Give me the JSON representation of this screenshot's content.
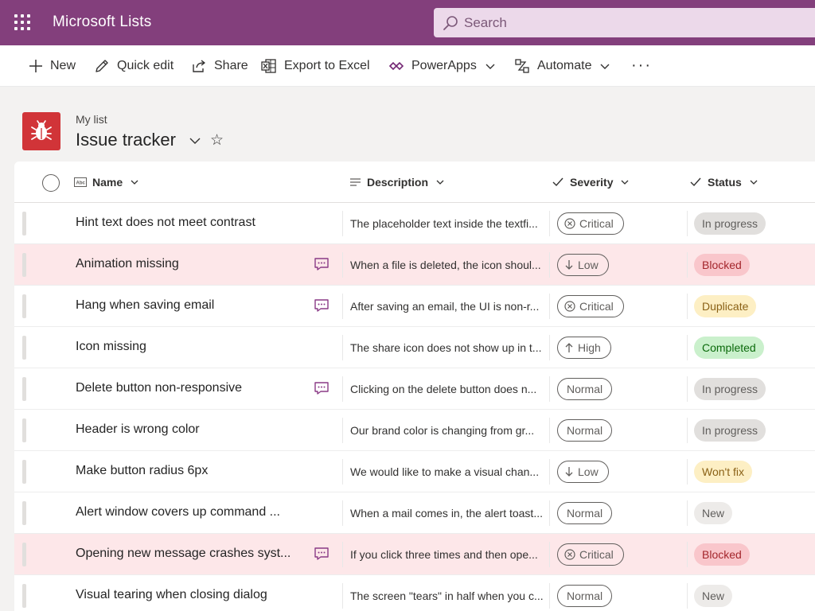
{
  "app": {
    "title": "Microsoft Lists",
    "search_placeholder": "Search"
  },
  "commands": {
    "new": "New",
    "quick_edit": "Quick edit",
    "share": "Share",
    "export": "Export to Excel",
    "powerapps": "PowerApps",
    "automate": "Automate",
    "more": "···"
  },
  "list": {
    "breadcrumb": "My list",
    "title": "Issue tracker"
  },
  "columns": {
    "name": "Name",
    "description": "Description",
    "severity": "Severity",
    "status": "Status"
  },
  "rows": [
    {
      "name": "Hint text does not meet contrast",
      "comment": false,
      "description": "The placeholder text inside the textfi...",
      "severity": "Critical",
      "status": "In progress",
      "highlight": false
    },
    {
      "name": "Animation missing",
      "comment": true,
      "description": "When a file is deleted, the icon shoul...",
      "severity": "Low",
      "status": "Blocked",
      "highlight": true
    },
    {
      "name": "Hang when saving email",
      "comment": true,
      "description": "After saving an email, the UI is non-r...",
      "severity": "Critical",
      "status": "Duplicate",
      "highlight": false
    },
    {
      "name": "Icon missing",
      "comment": false,
      "description": "The share icon does not show up in t...",
      "severity": "High",
      "status": "Completed",
      "highlight": false
    },
    {
      "name": "Delete button non-responsive",
      "comment": true,
      "description": "Clicking on the delete button does n...",
      "severity": "Normal",
      "status": "In progress",
      "highlight": false
    },
    {
      "name": "Header is wrong color",
      "comment": false,
      "description": "Our brand color is changing from gr...",
      "severity": "Normal",
      "status": "In progress",
      "highlight": false
    },
    {
      "name": "Make button radius 6px",
      "comment": false,
      "description": "We would like to make a visual chan...",
      "severity": "Low",
      "status": "Won't fix",
      "highlight": false
    },
    {
      "name": "Alert window covers up command ...",
      "comment": false,
      "description": "When a mail comes in, the alert toast...",
      "severity": "Normal",
      "status": "New",
      "highlight": false
    },
    {
      "name": "Opening new message crashes syst...",
      "comment": true,
      "description": "If you click three times and then ope...",
      "severity": "Critical",
      "status": "Blocked",
      "highlight": true
    },
    {
      "name": "Visual tearing when closing dialog",
      "comment": false,
      "description": "The screen \"tears\" in half when you c...",
      "severity": "Normal",
      "status": "New",
      "highlight": false
    }
  ],
  "status_colors": {
    "In progress": {
      "bg": "#e1dfdd",
      "fg": "#605e5c"
    },
    "Blocked": {
      "bg": "#f9c6cb",
      "fg": "#a4262c"
    },
    "Duplicate": {
      "bg": "#fdefc4",
      "fg": "#8a6116"
    },
    "Completed": {
      "bg": "#caf0cc",
      "fg": "#0b6a0b"
    },
    "Won't fix": {
      "bg": "#fdefc4",
      "fg": "#8a6116"
    },
    "New": {
      "bg": "#edebe9",
      "fg": "#605e5c"
    }
  },
  "colors": {
    "suite_bar": "#833f7c",
    "list_icon": "#d13438",
    "row_highlight": "#fde7e9",
    "comment_icon": "#8a3a86"
  }
}
